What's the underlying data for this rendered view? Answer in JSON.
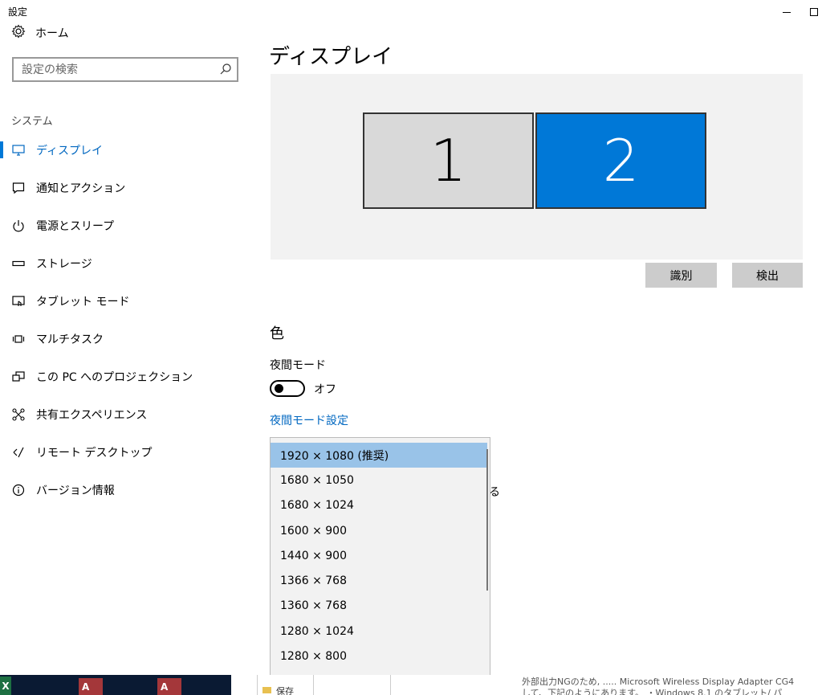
{
  "window": {
    "title": "設定"
  },
  "sidebar": {
    "home_label": "ホーム",
    "search_placeholder": "設定の検索",
    "section_label": "システム",
    "items": [
      {
        "label": "ディスプレイ",
        "icon": "monitor-icon",
        "active": true
      },
      {
        "label": "通知とアクション",
        "icon": "notification-icon",
        "active": false
      },
      {
        "label": "電源とスリープ",
        "icon": "power-icon",
        "active": false
      },
      {
        "label": "ストレージ",
        "icon": "storage-icon",
        "active": false
      },
      {
        "label": "タブレット モード",
        "icon": "tablet-mode-icon",
        "active": false
      },
      {
        "label": "マルチタスク",
        "icon": "multitask-icon",
        "active": false
      },
      {
        "label": "この PC へのプロジェクション",
        "icon": "projection-icon",
        "active": false
      },
      {
        "label": "共有エクスペリエンス",
        "icon": "shared-experience-icon",
        "active": false
      },
      {
        "label": "リモート デスクトップ",
        "icon": "remote-desktop-icon",
        "active": false
      },
      {
        "label": "バージョン情報",
        "icon": "info-icon",
        "active": false
      }
    ]
  },
  "main": {
    "title": "ディスプレイ",
    "monitors": [
      {
        "number": "1",
        "selected": false
      },
      {
        "number": "2",
        "selected": true
      }
    ],
    "identify_label": "識別",
    "detect_label": "検出",
    "color_heading": "色",
    "night_mode_label": "夜間モード",
    "night_mode_state": "オフ",
    "night_mode_settings_link": "夜間モード設定",
    "partial_text": "る"
  },
  "resolution_dropdown": {
    "selected": "1920 × 1080 (推奨)",
    "options": [
      "1920 × 1080 (推奨)",
      "1680 × 1050",
      "1680 × 1024",
      "1600 × 900",
      "1440 × 900",
      "1366 × 768",
      "1360 × 768",
      "1280 × 1024",
      "1280 × 800"
    ]
  },
  "background": {
    "folder_text": "保存",
    "text_line1": "外部出力NGのため, ..... Microsoft Wireless Display Adapter CG4",
    "text_line2": "して、下記のようにあります。 ・Windows 8.1 のタブレット/ パ"
  },
  "colors": {
    "accent": "#0078d7",
    "link": "#0067c0",
    "selected_item": "#99c3e8",
    "panel_bg": "#f2f2f2"
  }
}
